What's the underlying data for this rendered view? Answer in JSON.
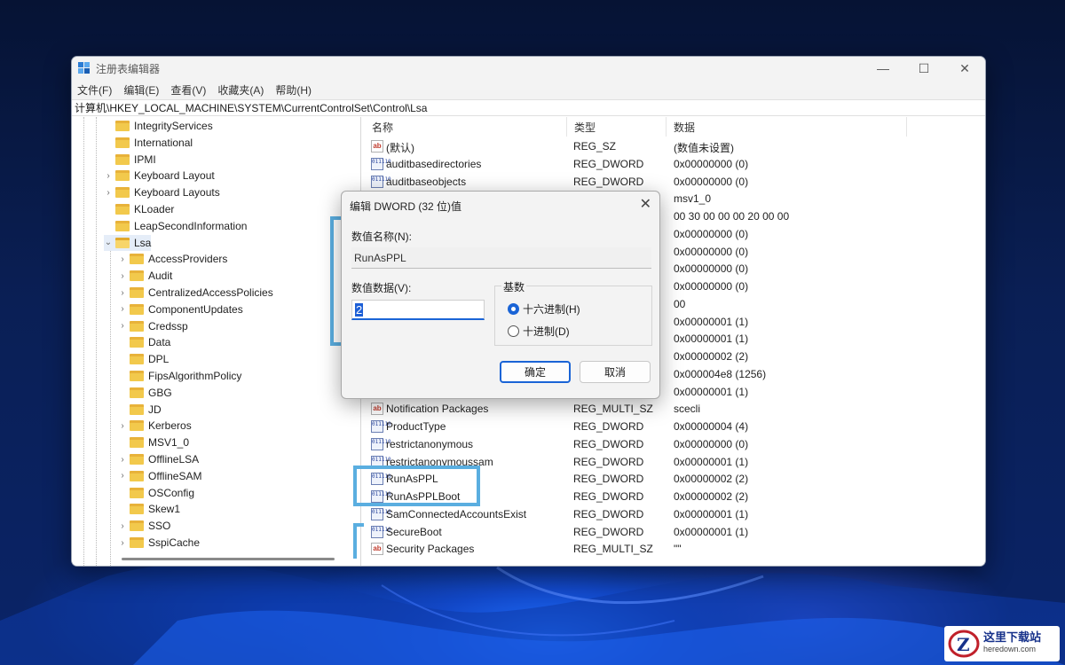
{
  "window": {
    "title": "注册表编辑器",
    "controls": {
      "minimize": "—",
      "maximize": "☐",
      "close": "✕"
    }
  },
  "menu": [
    "文件(F)",
    "编辑(E)",
    "查看(V)",
    "收藏夹(A)",
    "帮助(H)"
  ],
  "address": "计算机\\HKEY_LOCAL_MACHINE\\SYSTEM\\CurrentControlSet\\Control\\Lsa",
  "tree": {
    "items": [
      {
        "label": "IntegrityServices",
        "level": 0,
        "expandable": false
      },
      {
        "label": "International",
        "level": 0,
        "expandable": false
      },
      {
        "label": "IPMI",
        "level": 0,
        "expandable": false
      },
      {
        "label": "Keyboard Layout",
        "level": 0,
        "expandable": true
      },
      {
        "label": "Keyboard Layouts",
        "level": 0,
        "expandable": true
      },
      {
        "label": "KLoader",
        "level": 0,
        "expandable": false
      },
      {
        "label": "LeapSecondInformation",
        "level": 0,
        "expandable": false
      },
      {
        "label": "Lsa",
        "level": 0,
        "expandable": true,
        "expanded": true,
        "selected": true
      },
      {
        "label": "AccessProviders",
        "level": 1,
        "expandable": true
      },
      {
        "label": "Audit",
        "level": 1,
        "expandable": true
      },
      {
        "label": "CentralizedAccessPolicies",
        "level": 1,
        "expandable": true
      },
      {
        "label": "ComponentUpdates",
        "level": 1,
        "expandable": true
      },
      {
        "label": "Credssp",
        "level": 1,
        "expandable": true
      },
      {
        "label": "Data",
        "level": 1,
        "expandable": false
      },
      {
        "label": "DPL",
        "level": 1,
        "expandable": false
      },
      {
        "label": "FipsAlgorithmPolicy",
        "level": 1,
        "expandable": false
      },
      {
        "label": "GBG",
        "level": 1,
        "expandable": false
      },
      {
        "label": "JD",
        "level": 1,
        "expandable": false
      },
      {
        "label": "Kerberos",
        "level": 1,
        "expandable": true
      },
      {
        "label": "MSV1_0",
        "level": 1,
        "expandable": false
      },
      {
        "label": "OfflineLSA",
        "level": 1,
        "expandable": true
      },
      {
        "label": "OfflineSAM",
        "level": 1,
        "expandable": true
      },
      {
        "label": "OSConfig",
        "level": 1,
        "expandable": false
      },
      {
        "label": "Skew1",
        "level": 1,
        "expandable": false
      },
      {
        "label": "SSO",
        "level": 1,
        "expandable": true
      },
      {
        "label": "SspiCache",
        "level": 1,
        "expandable": true
      }
    ]
  },
  "values": {
    "headers": {
      "name": "名称",
      "type": "类型",
      "data": "数据"
    },
    "rows": [
      {
        "icon": "ab",
        "name": "(默认)",
        "type": "REG_SZ",
        "data": "(数值未设置)"
      },
      {
        "icon": "bin",
        "name": "auditbasedirectories",
        "type": "REG_DWORD",
        "data": "0x00000000 (0)"
      },
      {
        "icon": "bin",
        "name": "auditbaseobjects",
        "type": "REG_DWORD",
        "data": "0x00000000 (0)"
      },
      {
        "icon": "",
        "name": "",
        "type": "",
        "data": "msv1_0"
      },
      {
        "icon": "",
        "name": "",
        "type": "",
        "data": "00 30 00 00 00 20 00 00"
      },
      {
        "icon": "",
        "name": "",
        "type": "",
        "data": "0x00000000 (0)"
      },
      {
        "icon": "",
        "name": "",
        "type": "",
        "data": "0x00000000 (0)"
      },
      {
        "icon": "",
        "name": "",
        "type": "",
        "data": "0x00000000 (0)"
      },
      {
        "icon": "",
        "name": "",
        "type": "",
        "data": "0x00000000 (0)"
      },
      {
        "icon": "",
        "name": "",
        "type": "",
        "data": "00"
      },
      {
        "icon": "",
        "name": "",
        "type": "",
        "data": "0x00000001 (1)"
      },
      {
        "icon": "",
        "name": "",
        "type": "",
        "data": "0x00000001 (1)"
      },
      {
        "icon": "",
        "name": "",
        "type": "",
        "data": "0x00000002 (2)"
      },
      {
        "icon": "",
        "name": "",
        "type": "",
        "data": "0x000004e8 (1256)"
      },
      {
        "icon": "",
        "name": "",
        "type": "",
        "data": "0x00000001 (1)"
      },
      {
        "icon": "ab",
        "name": "Notification Packages",
        "type": "REG_MULTI_SZ",
        "data": "scecli"
      },
      {
        "icon": "bin",
        "name": "ProductType",
        "type": "REG_DWORD",
        "data": "0x00000004 (4)"
      },
      {
        "icon": "bin",
        "name": "restrictanonymous",
        "type": "REG_DWORD",
        "data": "0x00000000 (0)"
      },
      {
        "icon": "bin",
        "name": "restrictanonymoussam",
        "type": "REG_DWORD",
        "data": "0x00000001 (1)"
      },
      {
        "icon": "bin",
        "name": "RunAsPPL",
        "type": "REG_DWORD",
        "data": "0x00000002 (2)"
      },
      {
        "icon": "bin",
        "name": "RunAsPPLBoot",
        "type": "REG_DWORD",
        "data": "0x00000002 (2)"
      },
      {
        "icon": "bin",
        "name": "SamConnectedAccountsExist",
        "type": "REG_DWORD",
        "data": "0x00000001 (1)"
      },
      {
        "icon": "bin",
        "name": "SecureBoot",
        "type": "REG_DWORD",
        "data": "0x00000001 (1)"
      },
      {
        "icon": "ab",
        "name": "Security Packages",
        "type": "REG_MULTI_SZ",
        "data": "\"\""
      }
    ]
  },
  "dialog": {
    "title": "编辑 DWORD (32 位)值",
    "close": "✕",
    "name_label": "数值名称(N):",
    "name_value": "RunAsPPL",
    "data_label": "数值数据(V):",
    "data_value": "2",
    "base_label": "基数",
    "radio_hex": "十六进制(H)",
    "radio_dec": "十进制(D)",
    "selected_base": "hex",
    "ok": "确定",
    "cancel": "取消"
  },
  "watermark": {
    "title": "这里下载站",
    "url": "heredown.com"
  },
  "colors": {
    "accent": "#1a64d6",
    "highlight": "#5aaee0",
    "folder": "#f2c94c"
  }
}
